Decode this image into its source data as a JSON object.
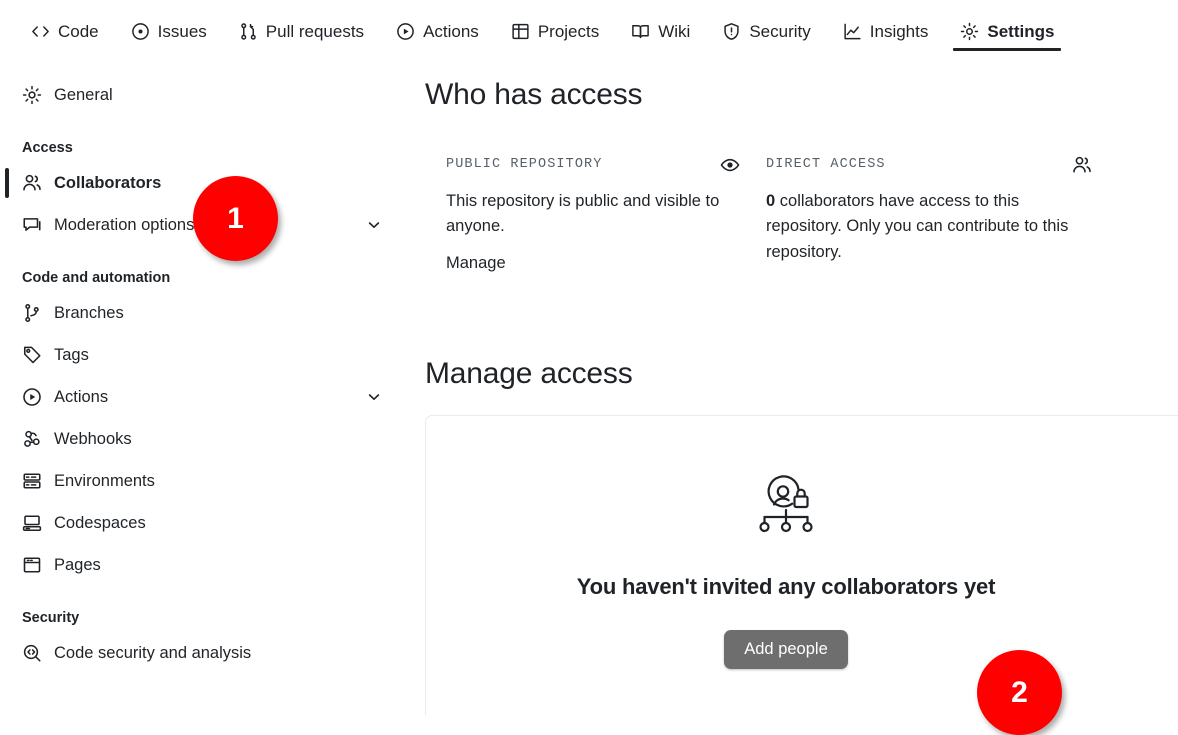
{
  "repo_nav": {
    "tabs": [
      {
        "label": "Code",
        "icon": "code-icon",
        "active": false
      },
      {
        "label": "Issues",
        "icon": "issue-opened-icon",
        "active": false
      },
      {
        "label": "Pull requests",
        "icon": "git-pull-request-icon",
        "active": false
      },
      {
        "label": "Actions",
        "icon": "play-icon",
        "active": false
      },
      {
        "label": "Projects",
        "icon": "table-icon",
        "active": false
      },
      {
        "label": "Wiki",
        "icon": "book-icon",
        "active": false
      },
      {
        "label": "Security",
        "icon": "shield-icon",
        "active": false
      },
      {
        "label": "Insights",
        "icon": "graph-icon",
        "active": false
      },
      {
        "label": "Settings",
        "icon": "gear-icon",
        "active": true
      }
    ]
  },
  "sidebar": {
    "top_items": [
      {
        "label": "General",
        "icon": "gear-icon",
        "active": false,
        "chevron": false
      }
    ],
    "groups": [
      {
        "title": "Access",
        "items": [
          {
            "label": "Collaborators",
            "icon": "people-icon",
            "active": true,
            "chevron": false
          },
          {
            "label": "Moderation options",
            "icon": "comment-icon",
            "active": false,
            "chevron": true
          }
        ]
      },
      {
        "title": "Code and automation",
        "items": [
          {
            "label": "Branches",
            "icon": "git-branch-icon",
            "active": false,
            "chevron": false
          },
          {
            "label": "Tags",
            "icon": "tag-icon",
            "active": false,
            "chevron": false
          },
          {
            "label": "Actions",
            "icon": "play-icon",
            "active": false,
            "chevron": true
          },
          {
            "label": "Webhooks",
            "icon": "webhook-icon",
            "active": false,
            "chevron": false
          },
          {
            "label": "Environments",
            "icon": "server-icon",
            "active": false,
            "chevron": false
          },
          {
            "label": "Codespaces",
            "icon": "codespaces-icon",
            "active": false,
            "chevron": false
          },
          {
            "label": "Pages",
            "icon": "browser-icon",
            "active": false,
            "chevron": false
          }
        ]
      },
      {
        "title": "Security",
        "items": [
          {
            "label": "Code security and analysis",
            "icon": "codescan-icon",
            "active": false,
            "chevron": false
          }
        ]
      }
    ]
  },
  "main": {
    "who_has_access_heading": "Who has access",
    "access_cards": [
      {
        "title": "PUBLIC REPOSITORY",
        "icon": "eye-icon",
        "body": "This repository is public and visible to anyone.",
        "body_lead": "",
        "link": "Manage"
      },
      {
        "title": "DIRECT ACCESS",
        "icon": "people-icon",
        "body_lead": "0",
        "body": " collaborators have access to this repository. Only you can contribute to this repository.",
        "link": ""
      }
    ],
    "manage_access_heading": "Manage access",
    "empty_state": {
      "icon": "access-hierarchy-lock-icon",
      "title": "You haven't invited any collaborators yet",
      "button_label": "Add people"
    }
  },
  "annotations": {
    "badges": [
      {
        "number": "1",
        "target": "sidebar-item-collaborators"
      },
      {
        "number": "2",
        "target": "add-people-button"
      }
    ],
    "color": "#ff0000"
  }
}
